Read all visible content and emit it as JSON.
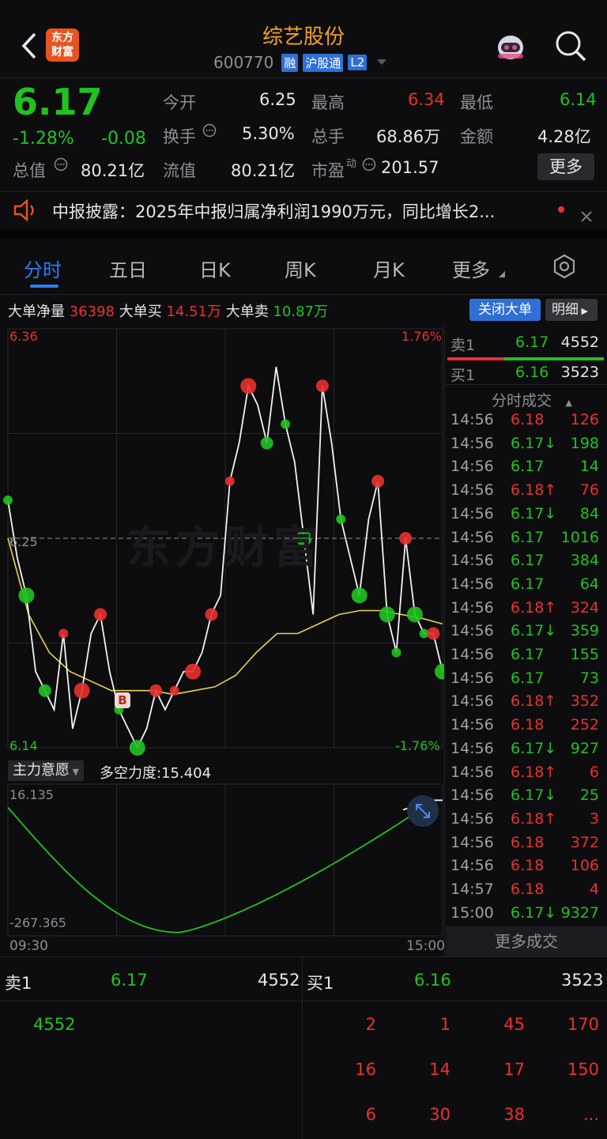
{
  "header": {
    "title": "综艺股份",
    "code": "600770",
    "tags": [
      "融",
      "沪股通",
      "L2"
    ],
    "logo_line1": "东方",
    "logo_line2": "财富"
  },
  "quote": {
    "price": "6.17",
    "change_pct": "-1.28%",
    "change": "-0.08",
    "fields": {
      "open_label": "今开",
      "open": "6.25",
      "high_label": "最高",
      "high": "6.34",
      "low_label": "最低",
      "low": "6.14",
      "turnover_label": "换手",
      "turnover": "5.30%",
      "volume_label": "总手",
      "volume": "68.86万",
      "amount_label": "金额",
      "amount": "4.28亿",
      "mktcap_label": "总值",
      "mktcap": "80.21亿",
      "float_label": "流值",
      "float": "80.21亿",
      "pe_label": "市盈",
      "pe_sup": "动",
      "pe": "201.57",
      "more_button": "更多"
    }
  },
  "notice": {
    "text": "中报披露：2025年中报归属净利润1990万元，同比增长2..."
  },
  "tabs": [
    "分时",
    "五日",
    "日K",
    "周K",
    "月K",
    "更多"
  ],
  "bigorder": {
    "net_label": "大单净量",
    "net": "36398",
    "buy_label": "大单买",
    "buy": "14.51万",
    "sell_label": "大单卖",
    "sell": "10.87万",
    "close_button": "关闭大单",
    "detail_button": "明细"
  },
  "chart": {
    "top_price": "6.36",
    "top_pct": "1.76%",
    "mid_price": "6.25",
    "bottom_price": "6.14",
    "bottom_pct": "-1.76%",
    "watermark": "东方财富",
    "indicator_label": "主力意愿",
    "indicator_value": "多空力度:15.404",
    "ind_top": "16.135",
    "ind_bottom": "-267.365",
    "time_start": "09:30",
    "time_end": "15:00",
    "b_marker": "B"
  },
  "chart_data": {
    "type": "line",
    "title": "",
    "ylim": [
      6.14,
      6.36
    ],
    "prev_close": 6.25,
    "x": [
      "09:30",
      "15:00"
    ],
    "series": [
      {
        "values": [
          6.27,
          6.24,
          6.22,
          6.18,
          6.17,
          6.16,
          6.2,
          6.15,
          6.17,
          6.2,
          6.21,
          6.18,
          6.16,
          6.15,
          6.14,
          6.15,
          6.17,
          6.16,
          6.17,
          6.18,
          6.18,
          6.19,
          6.21,
          6.22,
          6.28,
          6.3,
          6.33,
          6.32,
          6.3,
          6.34,
          6.31,
          6.29,
          6.25,
          6.21,
          6.33,
          6.3,
          6.26,
          6.24,
          6.22,
          6.26,
          6.28,
          6.21,
          6.19,
          6.25,
          6.21,
          6.2,
          6.2,
          6.18
        ]
      },
      {
        "values": [
          6.25,
          6.21,
          6.19,
          6.18,
          6.175,
          6.17,
          6.17,
          6.17,
          6.168,
          6.17,
          6.172,
          6.178,
          6.19,
          6.2,
          6.2,
          6.205,
          6.21,
          6.212,
          6.212,
          6.21,
          6.208,
          6.205
        ]
      }
    ],
    "indicator": {
      "ylim": [
        -267.365,
        16.135
      ],
      "last": 15.404
    }
  },
  "level1": {
    "sell1_label": "卖1",
    "sell1_price": "6.17",
    "sell1_vol": "4552",
    "buy1_label": "买1",
    "buy1_price": "6.16",
    "buy1_vol": "3523"
  },
  "trades_header": "分时成交",
  "trades": [
    {
      "t": "14:56",
      "p": "6.18",
      "d": "",
      "v": "126",
      "c": "red"
    },
    {
      "t": "14:56",
      "p": "6.17",
      "d": "↓",
      "v": "198",
      "c": "green"
    },
    {
      "t": "14:56",
      "p": "6.17",
      "d": "",
      "v": "14",
      "c": "green"
    },
    {
      "t": "14:56",
      "p": "6.18",
      "d": "↑",
      "v": "76",
      "c": "red"
    },
    {
      "t": "14:56",
      "p": "6.17",
      "d": "↓",
      "v": "84",
      "c": "green"
    },
    {
      "t": "14:56",
      "p": "6.17",
      "d": "",
      "v": "1016",
      "c": "green"
    },
    {
      "t": "14:56",
      "p": "6.17",
      "d": "",
      "v": "384",
      "c": "green"
    },
    {
      "t": "14:56",
      "p": "6.17",
      "d": "",
      "v": "64",
      "c": "green"
    },
    {
      "t": "14:56",
      "p": "6.18",
      "d": "↑",
      "v": "324",
      "c": "red"
    },
    {
      "t": "14:56",
      "p": "6.17",
      "d": "↓",
      "v": "359",
      "c": "green"
    },
    {
      "t": "14:56",
      "p": "6.17",
      "d": "",
      "v": "155",
      "c": "green"
    },
    {
      "t": "14:56",
      "p": "6.17",
      "d": "",
      "v": "73",
      "c": "green"
    },
    {
      "t": "14:56",
      "p": "6.18",
      "d": "↑",
      "v": "352",
      "c": "red"
    },
    {
      "t": "14:56",
      "p": "6.18",
      "d": "",
      "v": "252",
      "c": "red"
    },
    {
      "t": "14:56",
      "p": "6.17",
      "d": "↓",
      "v": "927",
      "c": "green"
    },
    {
      "t": "14:56",
      "p": "6.18",
      "d": "↑",
      "v": "6",
      "c": "red"
    },
    {
      "t": "14:56",
      "p": "6.17",
      "d": "↓",
      "v": "25",
      "c": "green"
    },
    {
      "t": "14:56",
      "p": "6.18",
      "d": "↑",
      "v": "3",
      "c": "red"
    },
    {
      "t": "14:56",
      "p": "6.18",
      "d": "",
      "v": "372",
      "c": "red"
    },
    {
      "t": "14:56",
      "p": "6.18",
      "d": "",
      "v": "106",
      "c": "red"
    },
    {
      "t": "14:57",
      "p": "6.18",
      "d": "",
      "v": "4",
      "c": "red"
    },
    {
      "t": "15:00",
      "p": "6.17",
      "d": "↓",
      "v": "9327",
      "c": "green"
    }
  ],
  "more_trades": "更多成交",
  "orderbook": {
    "sell1_label": "卖1",
    "sell1_price": "6.17",
    "sell1_vol": "4552",
    "buy1_label": "买1",
    "buy1_price": "6.16",
    "buy1_vol": "3523",
    "sell_queue": [
      "4552"
    ],
    "buy_queue": [
      [
        "2",
        "1",
        "45",
        "170"
      ],
      [
        "16",
        "14",
        "17",
        "150"
      ],
      [
        "6",
        "30",
        "38",
        "..."
      ]
    ]
  },
  "colors": {
    "up": "#e8312f",
    "down": "#20c220",
    "accent": "#2f7cf6",
    "title": "#f4a21b"
  }
}
